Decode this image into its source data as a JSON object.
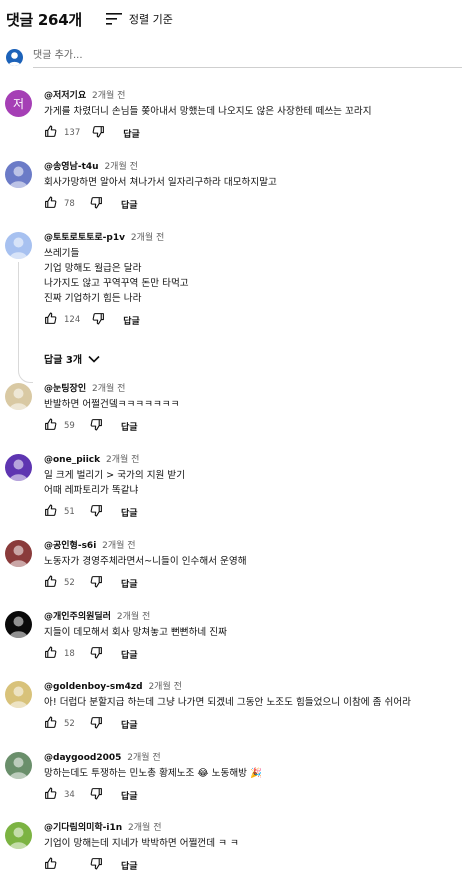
{
  "header": {
    "count_label": "댓글 264개",
    "sort_label": "정렬 기준"
  },
  "add_comment": {
    "placeholder": "댓글 추가..."
  },
  "reply_label": "답글",
  "comments": [
    {
      "author": "@저저기요",
      "time": "2개월 전",
      "lines": [
        "가게를 차렸더니 손님들 쫒아내서  망했는데 나오지도 않은 사장한테 떼쓰는 꼬라지"
      ],
      "likes": "137",
      "avatar": {
        "letter": "저",
        "color": "#a53fb5"
      }
    },
    {
      "author": "@송영남-t4u",
      "time": "2개월 전",
      "lines": [
        "회사가망하면 알아서 쳐나가서 일자리구하라 대모하지말고"
      ],
      "likes": "78",
      "avatar": {
        "letter": "",
        "color": "#6b7bc7"
      }
    },
    {
      "author": "@토토로토토로-p1v",
      "time": "2개월 전",
      "lines": [
        "쓰레기들",
        "기업 망해도 월급은 달라",
        "나가지도 않고 꾸역꾸역 돈만 타먹고",
        "진짜  기업하기 힘든 나라"
      ],
      "likes": "124",
      "replies_label": "답글 3개",
      "avatar": {
        "letter": "",
        "color": "#a7c1f0"
      }
    },
    {
      "author": "@눈팅장인",
      "time": "2개월 전",
      "lines": [
        "반발하면 어쩔건뎈ㅋㅋㅋㅋㅋㅋㅋ"
      ],
      "likes": "59",
      "avatar": {
        "letter": "",
        "color": "#d9c9a3"
      }
    },
    {
      "author": "@one_piick",
      "time": "2개월 전",
      "lines": [
        "일 크게 벌리기 > 국가의 지원 받기",
        "어때 레파토리가 똑같냐"
      ],
      "likes": "51",
      "avatar": {
        "letter": "",
        "color": "#5e35b1"
      }
    },
    {
      "author": "@공인형-s6i",
      "time": "2개월 전",
      "lines": [
        "노동자가 경영주체라면서~니들이 인수해서 운영해"
      ],
      "likes": "52",
      "avatar": {
        "letter": "",
        "color": "#8a3b3b"
      }
    },
    {
      "author": "@개인주의원딜러",
      "time": "2개월 전",
      "lines": [
        "지들이 데모해서 회사 망쳐놓고 뻔뻔하네 진짜"
      ],
      "likes": "18",
      "avatar": {
        "letter": "",
        "color": "#0a0a0a"
      }
    },
    {
      "author": "@goldenboy-sm4zd",
      "time": "2개월 전",
      "lines": [
        "아! 더럽다 분할지급 하는데 그냥 나가면 되겠네 그동안 노조도 힘들었으니 이참에 좀 쉬어라"
      ],
      "likes": "52",
      "avatar": {
        "letter": "",
        "color": "#d8c27a"
      }
    },
    {
      "author": "@daygood2005",
      "time": "2개월 전",
      "lines": [
        "망하는데도 투쟁하는 민노총 황제노조  😂  노동해방 🎉"
      ],
      "likes": "34",
      "avatar": {
        "letter": "",
        "color": "#6a8f6b"
      }
    },
    {
      "author": "@기다림의미학-i1n",
      "time": "2개월 전",
      "lines": [
        "기업이 망해는데 지네가 박박하면 어쩔껀데 ㅋ ㅋ"
      ],
      "likes": "",
      "avatar": {
        "letter": "",
        "color": "#7cb342"
      }
    }
  ]
}
